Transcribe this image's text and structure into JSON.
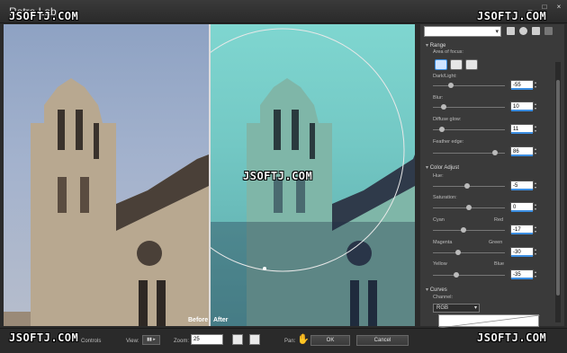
{
  "window": {
    "title": "Retro Lab",
    "controls": [
      "_",
      "□",
      "×"
    ]
  },
  "watermarks": {
    "text": "JSOFTJ.COM"
  },
  "preview": {
    "before_label": "Before",
    "after_label": "After"
  },
  "panel": {
    "preset_value": "",
    "range": {
      "title": "Range",
      "area_of_focus_label": "Area of focus:",
      "dark_light": {
        "label": "Dark/Light:",
        "value": "-55",
        "fraction": 0.25
      },
      "blur": {
        "label": "Blur:",
        "value": "10",
        "fraction": 0.15
      },
      "diffuse_glow": {
        "label": "Diffuse glow:",
        "value": "11",
        "fraction": 0.12
      },
      "feather_edge": {
        "label": "Feather edge:",
        "value": "86",
        "fraction": 0.86
      }
    },
    "color_adjust": {
      "title": "Color Adjust",
      "hue": {
        "label": "Hue:",
        "value": "-5",
        "fraction": 0.47
      },
      "saturation": {
        "label": "Saturation:",
        "value": "0",
        "fraction": 0.5
      },
      "cyan_red": {
        "left": "Cyan",
        "right": "Red",
        "value": "-17",
        "fraction": 0.42
      },
      "magenta_green": {
        "left": "Magenta",
        "right": "Green",
        "value": "-30",
        "fraction": 0.35
      },
      "yellow_blue": {
        "left": "Yellow",
        "right": "Blue",
        "value": "-35",
        "fraction": 0.33
      }
    },
    "curves": {
      "title": "Curves",
      "channel_label": "Channel:",
      "channel_value": "RGB"
    }
  },
  "bottombar": {
    "controls_label": "Controls",
    "view_label": "View:",
    "zoom_label": "Zoom:",
    "zoom_value": "25",
    "pan_label": "Pan:",
    "ok_label": "OK",
    "cancel_label": "Cancel"
  }
}
